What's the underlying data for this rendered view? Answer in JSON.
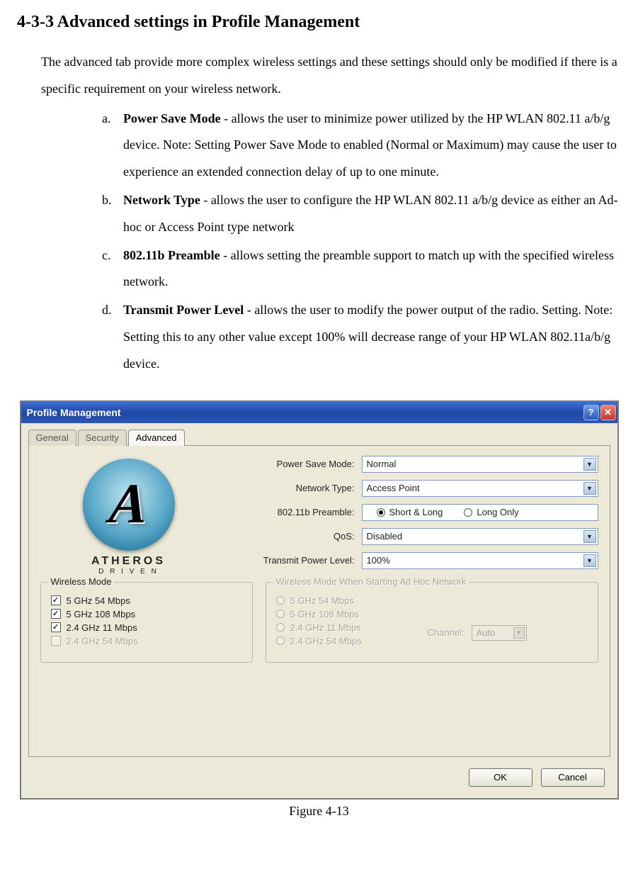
{
  "section_title": "4-3-3 Advanced settings in Profile Management",
  "intro": "The advanced tab provide more complex wireless settings and these settings should only be modified if there is a specific requirement on your wireless network.",
  "items": [
    {
      "marker": "a.",
      "bold": "Power Save Mode ",
      "rest": "- allows the user to minimize power utilized by the HP WLAN 802.11 a/b/g  device. Note: Setting Power Save Mode to enabled (Normal or Maximum) may cause the user to experience an extended connection delay of up to one minute."
    },
    {
      "marker": "b.",
      "bold": "Network Type",
      "rest": " - allows the user to configure the HP WLAN 802.11 a/b/g  device as either an Ad-hoc or Access Point type network"
    },
    {
      "marker": "c.",
      "bold": "802.11b Preamble ",
      "rest": "- allows setting the preamble support to match up with the specified wireless network."
    },
    {
      "marker": "d.",
      "bold": "Transmit Power Level",
      "rest": " - allows the user to modify the power output of the radio. Setting.  Note:  Setting this to any other value except 100% will decrease range of your HP WLAN 802.11a/b/g  device."
    }
  ],
  "figure_caption": "Figure 4-13",
  "window": {
    "title": "Profile Management",
    "tabs": {
      "general": "General",
      "security": "Security",
      "advanced": "Advanced"
    },
    "logo": {
      "letter": "A",
      "brand": "ATHEROS",
      "sub": "D R I V E N"
    },
    "fields": {
      "power_save_label": "Power Save Mode:",
      "power_save_value": "Normal",
      "network_type_label": "Network Type:",
      "network_type_value": "Access Point",
      "preamble_label": "802.11b Preamble:",
      "preamble_opt_short": "Short & Long",
      "preamble_opt_long": "Long Only",
      "qos_label": "QoS:",
      "qos_value": "Disabled",
      "tx_power_label": "Transmit Power Level:",
      "tx_power_value": "100%"
    },
    "wireless_mode": {
      "legend": "Wireless Mode",
      "opts": [
        {
          "label": "5 GHz 54 Mbps",
          "checked": true,
          "disabled": false
        },
        {
          "label": "5 GHz 108 Mbps",
          "checked": true,
          "disabled": false
        },
        {
          "label": "2.4 GHz 11 Mbps",
          "checked": true,
          "disabled": false
        },
        {
          "label": "2.4 GHz 54 Mbps",
          "checked": false,
          "disabled": true
        }
      ]
    },
    "adhoc": {
      "legend": "Wireless Mode When Starting Ad Hoc Network",
      "opts": [
        "5 GHz 54 Mbps",
        "5 GHz 108 Mbps",
        "2.4 GHz 11 Mbps",
        "2.4 GHz 54 Mbps"
      ],
      "channel_label": "Channel:",
      "channel_value": "Auto"
    },
    "buttons": {
      "ok": "OK",
      "cancel": "Cancel"
    }
  }
}
